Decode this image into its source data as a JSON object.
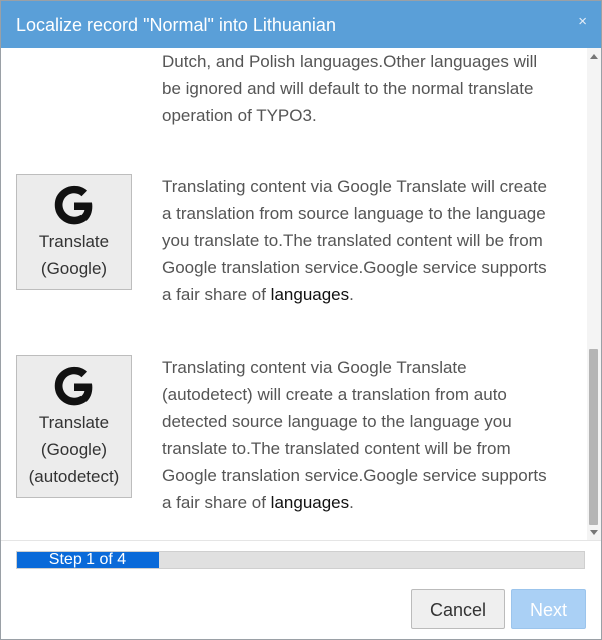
{
  "modal": {
    "title": "Localize record \"Normal\" into Lithuanian",
    "close_glyph": "×"
  },
  "options": [
    {
      "id": "partial",
      "button_label": null,
      "description_lines": [
        "Dutch, and Polish languages.Other languages will",
        "be ignored and will default to the normal translate",
        "operation of TYPO3."
      ]
    },
    {
      "id": "google",
      "icon": "google-g-icon",
      "button_label": [
        "Translate",
        "(Google)"
      ],
      "description_lines": [
        "Translating content via Google Translate will create",
        "a translation from source language to the language",
        "you translate to.The translated content will be from",
        "Google translation service.Google service supports"
      ],
      "last_line_prefix": "a fair share of ",
      "link_text": "languages",
      "last_line_suffix": "."
    },
    {
      "id": "google-autodetect",
      "icon": "google-g-icon",
      "button_label": [
        "Translate",
        "(Google)",
        "(autodetect)"
      ],
      "description_lines": [
        "Translating content via Google Translate",
        "(autodetect) will create a translation from auto",
        "detected source language to the language you",
        "translate to.The translated content will be from",
        "Google translation service.Google service supports"
      ],
      "last_line_prefix": "a fair share of ",
      "link_text": "languages",
      "last_line_suffix": "."
    }
  ],
  "progress": {
    "label": "Step 1 of 4",
    "step": 1,
    "total": 4,
    "fill_fraction": 0.25
  },
  "footer": {
    "cancel_label": "Cancel",
    "next_label": "Next"
  },
  "colors": {
    "header_bg": "#5a9fd8",
    "progress_fill": "#0a6ad9",
    "next_button_bg": "#aad0f5"
  }
}
